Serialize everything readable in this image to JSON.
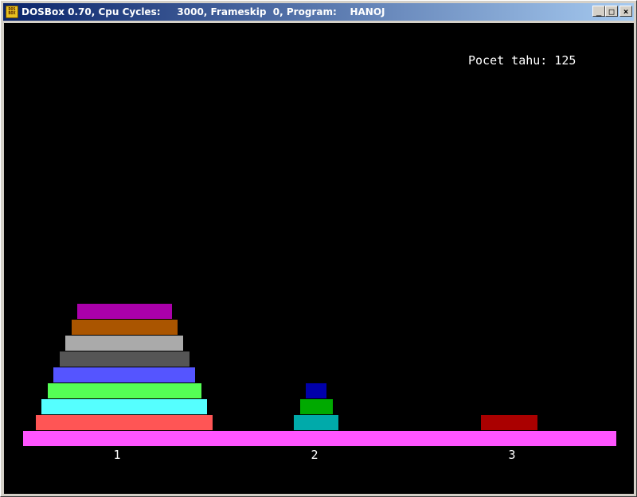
{
  "window": {
    "title": "DOSBox 0.70, Cpu Cycles:     3000, Frameskip  0, Program:    HANOJ",
    "icon": "dosbox-icon",
    "controls": {
      "minimize": "_",
      "maximize": "□",
      "close": "×"
    }
  },
  "game": {
    "move_counter": "Pocet tahu: 125",
    "base_color": "#ff55ff",
    "pegs": [
      {
        "label": "1",
        "disks": [
          {
            "size": 10,
            "color": "#ff5555"
          },
          {
            "size": 9,
            "color": "#55ffff"
          },
          {
            "size": 8,
            "color": "#55ff55"
          },
          {
            "size": 7,
            "color": "#5555ff"
          },
          {
            "size": 6,
            "color": "#555555"
          },
          {
            "size": 5,
            "color": "#aaaaaa"
          },
          {
            "size": 4,
            "color": "#aa5500"
          },
          {
            "size": 3,
            "color": "#aa00aa"
          }
        ]
      },
      {
        "label": "2",
        "disks": [
          {
            "size": 3,
            "color": "#00aaaa"
          },
          {
            "size": 2,
            "color": "#00aa00"
          },
          {
            "size": 1,
            "color": "#0000aa"
          }
        ]
      },
      {
        "label": "3",
        "disks": [
          {
            "size": 4,
            "color": "#aa0000"
          }
        ]
      }
    ]
  }
}
